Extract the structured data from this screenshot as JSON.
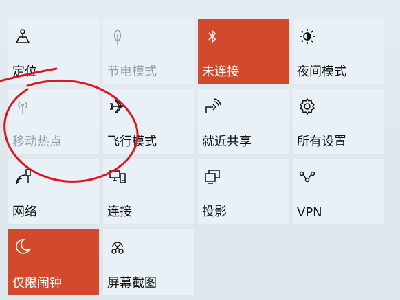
{
  "quick_actions": [
    {
      "label": "定位",
      "icon": "location-icon",
      "state": "normal"
    },
    {
      "label": "节电模式",
      "icon": "battery-saver-icon",
      "state": "disabled"
    },
    {
      "label": "未连接",
      "icon": "bluetooth-icon",
      "state": "active"
    },
    {
      "label": "夜间模式",
      "icon": "night-light-icon",
      "state": "normal"
    },
    {
      "label": "移动热点",
      "icon": "mobile-hotspot-icon",
      "state": "disabled"
    },
    {
      "label": "飞行模式",
      "icon": "airplane-icon",
      "state": "normal"
    },
    {
      "label": "就近共享",
      "icon": "nearby-share-icon",
      "state": "normal"
    },
    {
      "label": "所有设置",
      "icon": "settings-gear-icon",
      "state": "normal"
    },
    {
      "label": "网络",
      "icon": "network-icon",
      "state": "normal"
    },
    {
      "label": "连接",
      "icon": "connect-icon",
      "state": "normal"
    },
    {
      "label": "投影",
      "icon": "project-icon",
      "state": "normal"
    },
    {
      "label": "VPN",
      "icon": "vpn-icon",
      "state": "normal"
    },
    {
      "label": "仅限闹钟",
      "icon": "moon-icon",
      "state": "active"
    },
    {
      "label": "屏幕截图",
      "icon": "screen-snip-icon",
      "state": "normal"
    }
  ],
  "colors": {
    "active": "#d14a2b",
    "tile": "#e9f1f7",
    "disabled_text": "#9aa0a5",
    "annotation": "#e0141e"
  }
}
